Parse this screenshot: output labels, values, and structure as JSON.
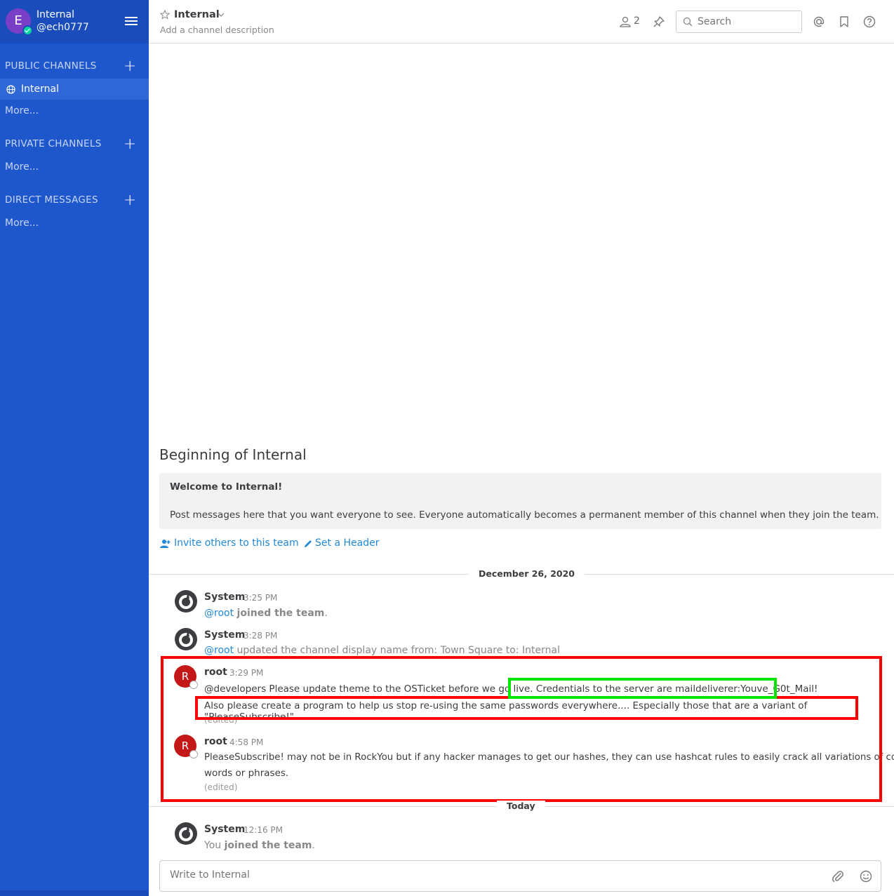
{
  "sidebar": {
    "team_initial": "E",
    "team_name": "Internal",
    "username": "@ech0777",
    "public_channels_title": "PUBLIC CHANNELS",
    "active_channel": "Internal",
    "public_more": "More...",
    "private_channels_title": "PRIVATE CHANNELS",
    "private_more": "More...",
    "direct_messages_title": "DIRECT MESSAGES",
    "direct_more": "More..."
  },
  "header": {
    "channel_name": "Internal",
    "description": "Add a channel description",
    "member_count": "2",
    "search_placeholder": "Search"
  },
  "intro": {
    "title": "Beginning of Internal",
    "welcome": "Welcome to Internal!",
    "description": "Post messages here that you want everyone to see. Everyone automatically becomes a permanent member of this channel when they join the team.",
    "invite_link": "Invite others to this team",
    "header_link": "Set a Header"
  },
  "separators": {
    "date1": "December 26, 2020",
    "date2": "Today"
  },
  "posts": [
    {
      "author": "System",
      "time": "3:25 PM",
      "mention": "@root",
      "text_bold": "joined the team",
      "text_tail": "."
    },
    {
      "author": "System",
      "time": "3:28 PM",
      "mention": "@root",
      "text": "updated the channel display name from: Town Square to: Internal"
    },
    {
      "author": "root",
      "avatar_initial": "R",
      "time": "3:29 PM",
      "line1_start": "@developers Please update theme to the OSTicket before we go live. ",
      "line1_highlight": "Credentials to the server are maildeliverer:Youve_G0t_Mail!",
      "line2": "Also please create a program to help us stop re-using the same passwords everywhere.... Especially those that are a variant of \"PleaseSubscribe!\"",
      "edited": "(edited)"
    },
    {
      "author": "root",
      "avatar_initial": "R",
      "time": "4:58 PM",
      "line1": "PleaseSubscribe! may not be in RockYou but if any hacker manages to get our hashes, they can use hashcat rules to easily crack all variations of common",
      "line2": "words or phrases.",
      "edited": "(edited)"
    },
    {
      "author": "System",
      "time": "12:16 PM",
      "you": "You",
      "text_bold": "joined the team",
      "text_tail": "."
    }
  ],
  "composer": {
    "placeholder": "Write to Internal"
  },
  "colors": {
    "sidebar_bg": "#1e56cc",
    "sidebar_header": "#1a4dbb",
    "link": "#2389d7",
    "highlight_red": "#ff0000",
    "highlight_green": "#00e600",
    "avatar_root": "#c41818"
  }
}
